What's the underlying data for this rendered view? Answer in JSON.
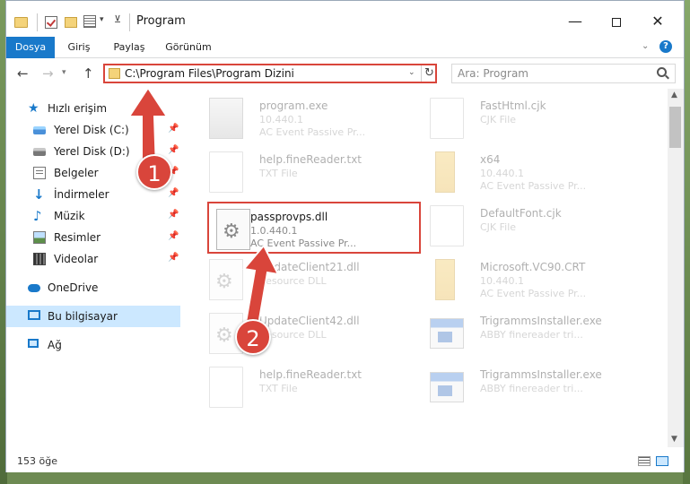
{
  "window": {
    "title": "Program"
  },
  "ribbon": {
    "tabs": [
      "Dosya",
      "Giriş",
      "Paylaş",
      "Görünüm"
    ]
  },
  "address": {
    "path": "C:\\Program Files\\Program Dizini"
  },
  "search": {
    "placeholder": "Ara: Program"
  },
  "navpane": {
    "quick_access": "Hızlı erişim",
    "items": [
      {
        "label": "Yerel Disk (C:)",
        "icon": "drive-icon"
      },
      {
        "label": "Yerel Disk (D:)",
        "icon": "drive-icon"
      },
      {
        "label": "Belgeler",
        "icon": "documents-icon"
      },
      {
        "label": "İndirmeler",
        "icon": "downloads-icon"
      },
      {
        "label": "Müzik",
        "icon": "music-icon"
      },
      {
        "label": "Resimler",
        "icon": "pictures-icon"
      },
      {
        "label": "Videolar",
        "icon": "videos-icon"
      }
    ],
    "onedrive": "OneDrive",
    "this_pc": "Bu bilgisayar",
    "network": "Ağ"
  },
  "files": [
    {
      "name": "program.exe",
      "line2": "10.440.1",
      "line3": "AC Event Passive Pr...",
      "icon": "exe-icon"
    },
    {
      "name": "FastHtml.cjk",
      "line2": "CJK File",
      "line3": "",
      "icon": "file-icon"
    },
    {
      "name": "help.fineReader.txt",
      "line2": "TXT File",
      "line3": "",
      "icon": "file-icon"
    },
    {
      "name": "x64",
      "line2": "10.440.1",
      "line3": "AC Event Passive Pr...",
      "icon": "folder-icon"
    },
    {
      "name": "passprovps.dll",
      "line2": "1.0.440.1",
      "line3": "AC Event Passive Pr...",
      "icon": "dll-icon"
    },
    {
      "name": "DefaultFont.cjk",
      "line2": "CJK File",
      "line3": "",
      "icon": "file-icon"
    },
    {
      "name": "UpdateClient21.dll",
      "line2": "Resource DLL",
      "line3": "",
      "icon": "dll-icon"
    },
    {
      "name": "Microsoft.VC90.CRT",
      "line2": "10.440.1",
      "line3": "AC Event Passive Pr...",
      "icon": "folder-icon"
    },
    {
      "name": "UpdateClient42.dll",
      "line2": "Resource DLL",
      "line3": "",
      "icon": "dll-icon"
    },
    {
      "name": "TrigrammsInstaller.exe",
      "line2": "ABBY finereader tri...",
      "line3": "",
      "icon": "exe-icon"
    },
    {
      "name": "help.fineReader.txt",
      "line2": "TXT File",
      "line3": "",
      "icon": "file-icon"
    },
    {
      "name": "TrigrammsInstaller.exe",
      "line2": "ABBY finereader tri...",
      "line3": "",
      "icon": "exe-icon"
    }
  ],
  "status": {
    "count": "153 öğe"
  },
  "annotations": {
    "badge1": "1",
    "badge2": "2"
  },
  "colors": {
    "accent": "#1979ca",
    "highlight": "#d9453b"
  }
}
